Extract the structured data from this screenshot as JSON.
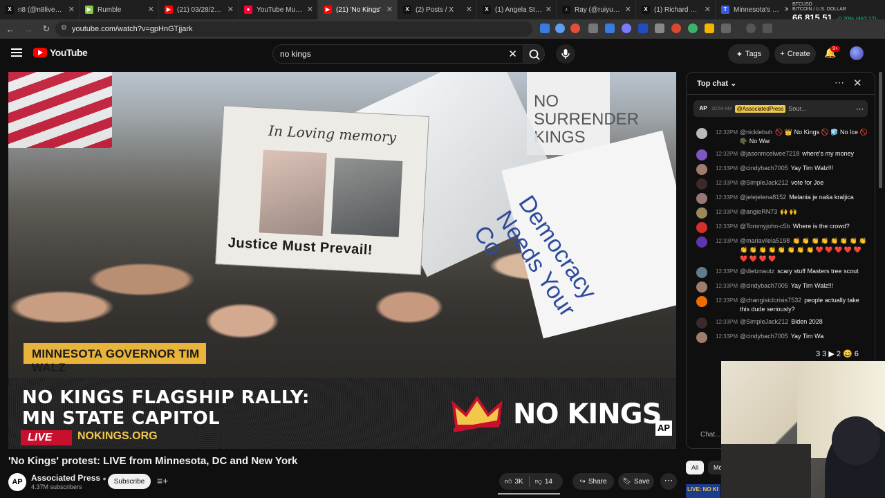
{
  "browser": {
    "tabs": [
      {
        "label": "n8 (@n8livenow) /",
        "color": "#111111",
        "glyph": "X"
      },
      {
        "label": "Rumble",
        "color": "#85c742",
        "glyph": "▶"
      },
      {
        "label": "(21) 03/28/26 - N",
        "color": "#ff0000",
        "glyph": "▶"
      },
      {
        "label": "YouTube Music",
        "color": "#ff0033",
        "glyph": "●"
      },
      {
        "label": "(21) 'No Kings'",
        "color": "#ff0000",
        "glyph": "▶",
        "active": true
      },
      {
        "label": "(2) Posts / X",
        "color": "#111111",
        "glyph": "X"
      },
      {
        "label": "(1) Angela Stanton",
        "color": "#111111",
        "glyph": "X"
      },
      {
        "label": "Ray (@ruiyu5980)",
        "color": "#111111",
        "glyph": "♪"
      },
      {
        "label": "(1) Richard Spenc",
        "color": "#111111",
        "glyph": "X"
      },
      {
        "label": "Minnesota's Rebel",
        "color": "#3a5bd9",
        "glyph": "T"
      }
    ],
    "url": "youtube.com/watch?v=gpHnGTjjark",
    "ticker": {
      "symbol": "BTCUSD",
      "subtitle": "BITCOIN / U.S. DOLLAR",
      "price": "66,815.51",
      "change": "-0.70% (462.17)"
    }
  },
  "youtube": {
    "logo_text": "YouTube",
    "search_value": "no kings",
    "tags_label": "Tags",
    "create_label": "Create",
    "notifications_badge": "9+"
  },
  "video": {
    "sign_memory": "In Loving memory",
    "sign_justice": "Justice Must Prevail!",
    "sign_democracy": "Democracy Needs Your Co",
    "sign_surrender": "NO SURRENDER KINGS",
    "lower_third": "MINNESOTA GOVERNOR TIM WALZ",
    "rally_line1": "NO KINGS FLAGSHIP RALLY:",
    "rally_line2": "MN STATE CAPITOL",
    "live_label": "LIVE",
    "site": "NOKINGS.ORG",
    "brand": "NO KINGS",
    "ap": "AP",
    "title": "'No Kings' protest: LIVE from Minnesota, DC and New York"
  },
  "channel": {
    "avatar": "AP",
    "name": "Associated Press",
    "subscribers": "4.37M subscribers",
    "subscribe_label": "Subscribe"
  },
  "actions": {
    "likes": "3K",
    "dislikes": "14",
    "share_label": "Share",
    "save_label": "Save"
  },
  "chat": {
    "header": "Top chat",
    "pinned": {
      "time": "10:54 AM",
      "author": "@AssociatedPress",
      "text": "Sour..."
    },
    "messages": [
      {
        "time": "12:32PM",
        "author": "@nicklebuh",
        "text": "🚫 👑 No Kings 🚫 🧊 No Ice 🚫 🪖 No War",
        "avatar": "#bbbbbb"
      },
      {
        "time": "12:32PM",
        "author": "@jasonmcelwee7218",
        "text": "where's my money",
        "avatar": "#7e57c2"
      },
      {
        "time": "12:33PM",
        "author": "@cindybach7005",
        "text": "Yay Tim Walz!!!",
        "avatar": "#a07c6d"
      },
      {
        "time": "12:33PM",
        "author": "@SimpleJack212",
        "text": "vote for Joe",
        "avatar": "#3a2a2a"
      },
      {
        "time": "12:33PM",
        "author": "@jelejelena8152",
        "text": "Melania je naša kraljica",
        "avatar": "#9a7777"
      },
      {
        "time": "12:33PM",
        "author": "@angieRN73",
        "text": "🙌 🙌",
        "avatar": "#9a8a5a"
      },
      {
        "time": "12:33PM",
        "author": "@Tommyjohn-c5b",
        "text": "Where is the crowd?",
        "avatar": "#d32f2f"
      },
      {
        "time": "12:33PM",
        "author": "@mariavilela5198",
        "text": "👏 👏 👏 👏 👏 👏 👏 👏 👏 👏 👏 👏 👏 👏 👏 👏 ❤️ ❤️ ❤️ ❤️ ❤️ ❤️ ❤️ ❤️ ❤️",
        "avatar": "#5e35b1"
      },
      {
        "time": "12:33PM",
        "author": "@dietznautz",
        "text": "scary stuff Masters tree scout",
        "avatar": "#607d8b"
      },
      {
        "time": "12:33PM",
        "author": "@cindybach7005",
        "text": "Yay Tim Walz!!!",
        "avatar": "#a07c6d"
      },
      {
        "time": "12:33PM",
        "author": "@changisiclcrisis7532",
        "text": "people actually take this dude seriously?",
        "avatar": "#ef6c00"
      },
      {
        "time": "12:33PM",
        "author": "@SimpleJack212",
        "text": "Biden 2028",
        "avatar": "#3a2a2a"
      },
      {
        "time": "12:33PM",
        "author": "@cindybach7005",
        "text": "Yay Tim Wa",
        "avatar": "#a07c6d"
      }
    ],
    "overflow_counts": "3 3 ▶ 2 😄 6",
    "input_placeholder": "Chat...",
    "chips": [
      {
        "label": "All",
        "active": true
      },
      {
        "label": "Mo",
        "active": false
      }
    ],
    "thumb_label": "LIVE: NO KI"
  }
}
